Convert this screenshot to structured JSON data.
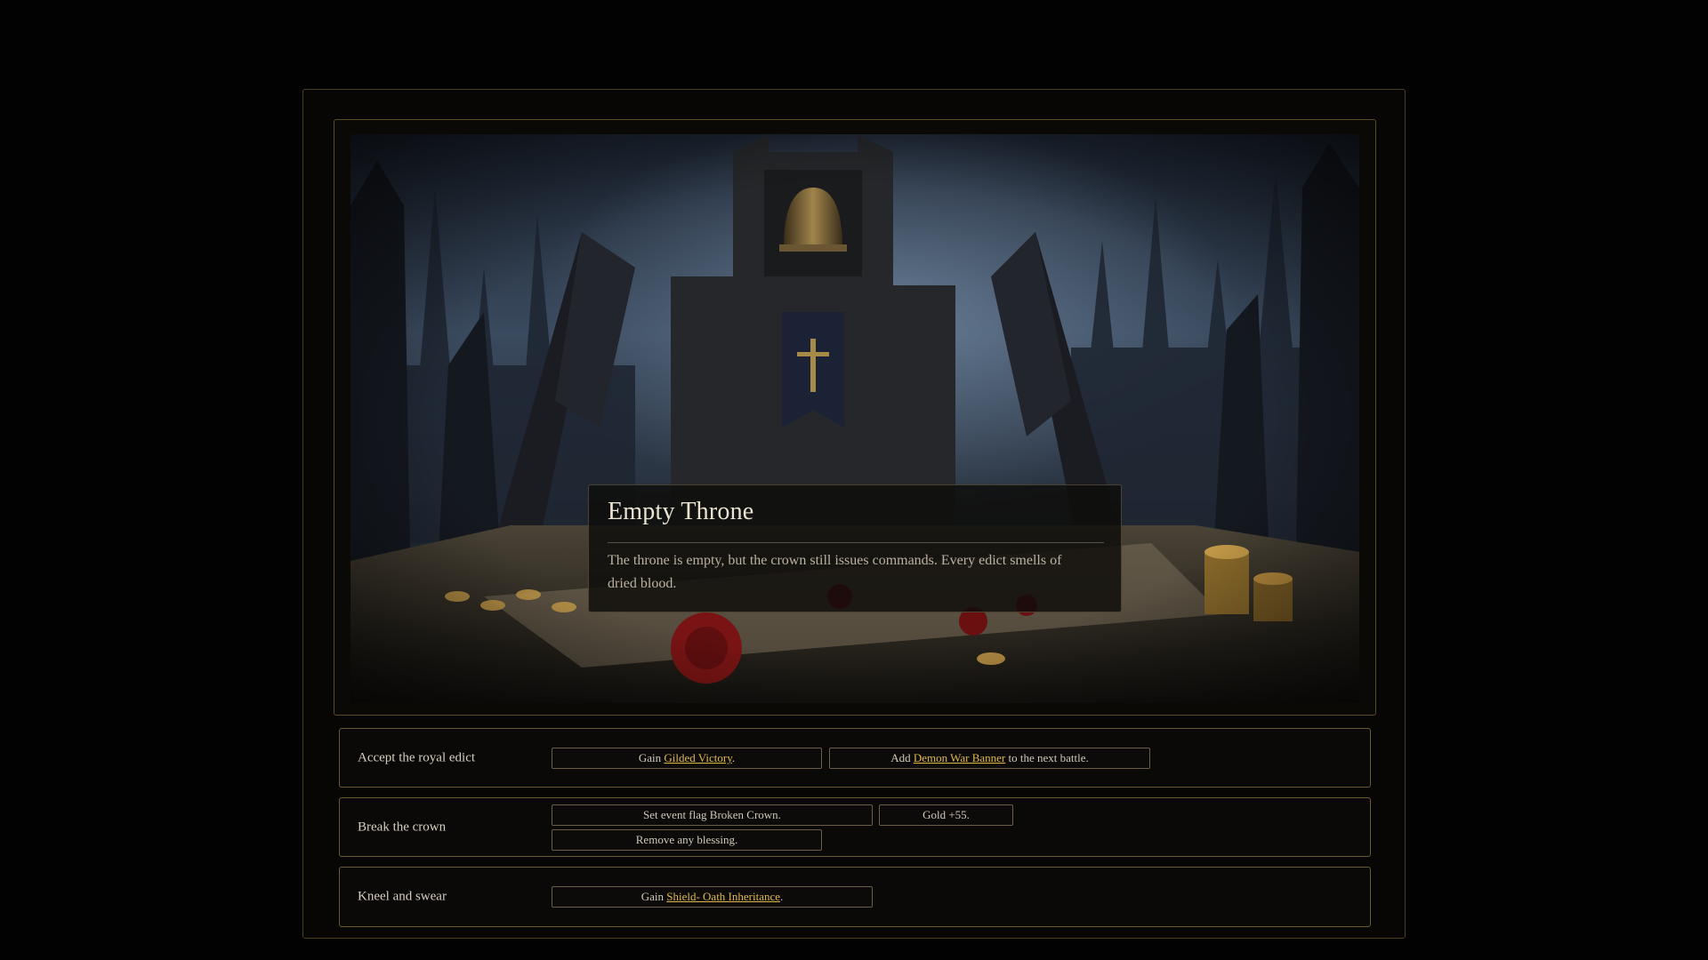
{
  "event": {
    "title": "Empty Throne",
    "description": "The throne is empty, but the crown still issues commands. Every edict smells of dried blood."
  },
  "choices": [
    {
      "label": "Accept the royal edict",
      "effects": [
        {
          "pre": "Gain ",
          "link": "Gilded Victory",
          "post": "."
        },
        {
          "pre": "Add ",
          "link": "Demon War Banner",
          "post": " to the next battle."
        }
      ]
    },
    {
      "label": "Break the crown",
      "effects": [
        {
          "pre": "Set event flag Broken Crown."
        },
        {
          "pre": "Gold +55."
        },
        {
          "pre": "Remove any blessing."
        }
      ]
    },
    {
      "label": "Kneel and swear",
      "effects": [
        {
          "pre": "Gain ",
          "link": "Shield- Oath Inheritance",
          "post": "."
        }
      ]
    }
  ],
  "colors": {
    "accent_gold": "#e0b84c",
    "frame_border": "#5a4a26",
    "background": "#020202"
  },
  "icons": [
    "bell",
    "crown-banner",
    "wax-seal",
    "coin-stack"
  ]
}
